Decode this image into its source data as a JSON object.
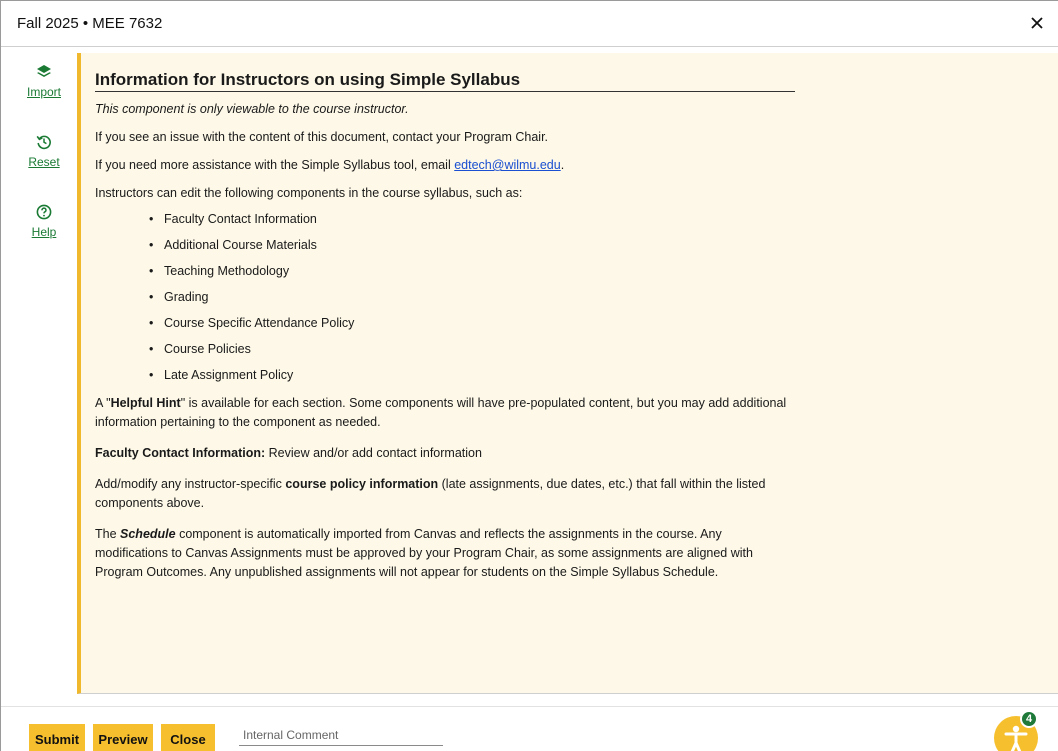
{
  "window": {
    "title": "Fall 2025 • MEE 7632"
  },
  "sidebar": {
    "items": [
      {
        "label": "Import",
        "icon": "layers-icon"
      },
      {
        "label": "Reset",
        "icon": "history-icon"
      },
      {
        "label": "Help",
        "icon": "help-circle-icon"
      }
    ]
  },
  "document": {
    "heading": "Information for Instructors on using Simple Syllabus",
    "note": "This component is only viewable to the course instructor.",
    "p_issue": "If you see an issue with the content of this document, contact your Program Chair.",
    "p_assist_pre": "If you need more assistance with the Simple Syllabus tool, email ",
    "p_assist_link": "edtech@wilmu.edu",
    "p_assist_post": ".",
    "p_edit": "Instructors can edit the following components in the course syllabus, such as:",
    "components": [
      "Faculty Contact Information",
      "Additional Course Materials",
      "Teaching Methodology",
      "Grading",
      "Course Specific Attendance Policy",
      "Course Policies",
      "Late Assignment Policy"
    ],
    "hint_pre": "A \"",
    "hint_bold": "Helpful Hint",
    "hint_post": "\" is available for each section. Some components will have pre-populated content, but you may add additional information pertaining to the component as needed.",
    "faculty_bold": "Faculty Contact Information:",
    "faculty_text": " Review and/or add contact information",
    "policy_pre": "Add/modify any instructor-specific ",
    "policy_bold": "course policy information",
    "policy_post": " (late assignments, due dates, etc.) that fall within the listed components above.",
    "schedule_pre": "The ",
    "schedule_bold": "Schedule",
    "schedule_post": " component is automatically imported from Canvas and reflects the assignments in the course. Any modifications to Canvas Assignments must be approved by your Program Chair, as some assignments are aligned with Program Outcomes. Any unpublished assignments will not appear for students on the Simple Syllabus Schedule."
  },
  "footer": {
    "submit_label": "Submit",
    "preview_label": "Preview",
    "close_label": "Close",
    "comment_placeholder": "Internal Comment",
    "accessibility_badge": "4"
  },
  "colors": {
    "accent": "#f6bf2d",
    "link_green": "#1a7a34",
    "content_bg": "#fdf8e7",
    "badge_green": "#1f7a3a"
  }
}
